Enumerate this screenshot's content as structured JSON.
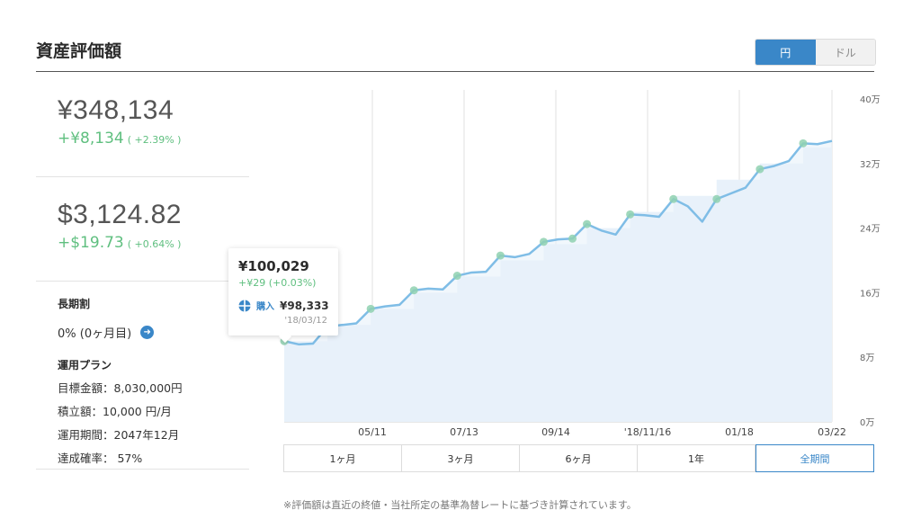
{
  "header": {
    "title": "資産評価額",
    "currency_toggle": {
      "jpy_label": "円",
      "usd_label": "ドル",
      "selected": "円"
    }
  },
  "summary": {
    "jpy": {
      "value": "¥348,134",
      "change": "+¥8,134",
      "change_pct": "( +2.39% )"
    },
    "usd": {
      "value": "$3,124.82",
      "change": "+$19.73",
      "change_pct": "( +0.64% )"
    }
  },
  "long_term": {
    "label": "長期割",
    "value": "0% (0ヶ月目)"
  },
  "plan": {
    "label": "運用プラン",
    "rows": [
      "目標金額：8,030,000円",
      "積立額：10,000 円/月",
      "運用期間：2047年12月",
      "達成確率： 57%"
    ]
  },
  "tooltip": {
    "value": "¥100,029",
    "change": "+¥29 (+0.03%)",
    "buy_label": "購入",
    "buy_amount": "¥98,333",
    "date": "'18/03/12"
  },
  "period_tabs": [
    "1ヶ月",
    "3ヶ月",
    "6ヶ月",
    "1年",
    "全期間"
  ],
  "period_selected": "全期間",
  "footnote": "※評価額は直近の終値・当社所定の基準為替レートに基づき計算されています。",
  "colors": {
    "accent": "#3a87c8",
    "positive": "#5fbf7f",
    "line": "#7fbde6",
    "area": "#e8f1fa",
    "marker": "#8fd1b0"
  },
  "chart_data": {
    "type": "area",
    "x_tick_labels": [
      "05/11",
      "07/13",
      "09/14",
      "'18/11/16",
      "01/18",
      "03/22"
    ],
    "y_tick_labels": [
      "0万",
      "8万",
      "16万",
      "24万",
      "32万",
      "40万"
    ],
    "ylim": [
      0,
      40
    ],
    "y_unit": "万円",
    "series": [
      {
        "values": [
          10.0,
          9.6,
          9.7,
          11.8,
          12.0,
          12.2,
          14.0,
          14.3,
          14.5,
          16.3,
          16.5,
          16.4,
          18.1,
          18.5,
          18.6,
          20.6,
          20.4,
          20.8,
          22.3,
          22.6,
          22.7,
          24.5,
          23.7,
          23.2,
          25.7,
          25.6,
          25.4,
          27.6,
          26.7,
          24.8,
          27.6,
          28.3,
          29.0,
          31.3,
          31.7,
          32.3,
          34.5,
          34.4,
          34.8
        ]
      },
      {
        "values": [
          10.0,
          10.0,
          10.0,
          12.0,
          12.0,
          12.0,
          14.0,
          14.0,
          14.0,
          16.0,
          16.0,
          16.0,
          18.0,
          18.0,
          18.0,
          20.0,
          20.0,
          20.0,
          22.0,
          22.0,
          22.0,
          24.0,
          24.0,
          24.0,
          26.0,
          26.0,
          26.0,
          28.0,
          28.0,
          28.0,
          30.0,
          30.0,
          30.0,
          32.0,
          32.0,
          32.0,
          34.0,
          34.0,
          34.0
        ]
      }
    ],
    "markers_index": [
      0,
      3,
      6,
      9,
      12,
      15,
      18,
      20,
      21,
      24,
      27,
      30,
      33,
      36
    ]
  }
}
